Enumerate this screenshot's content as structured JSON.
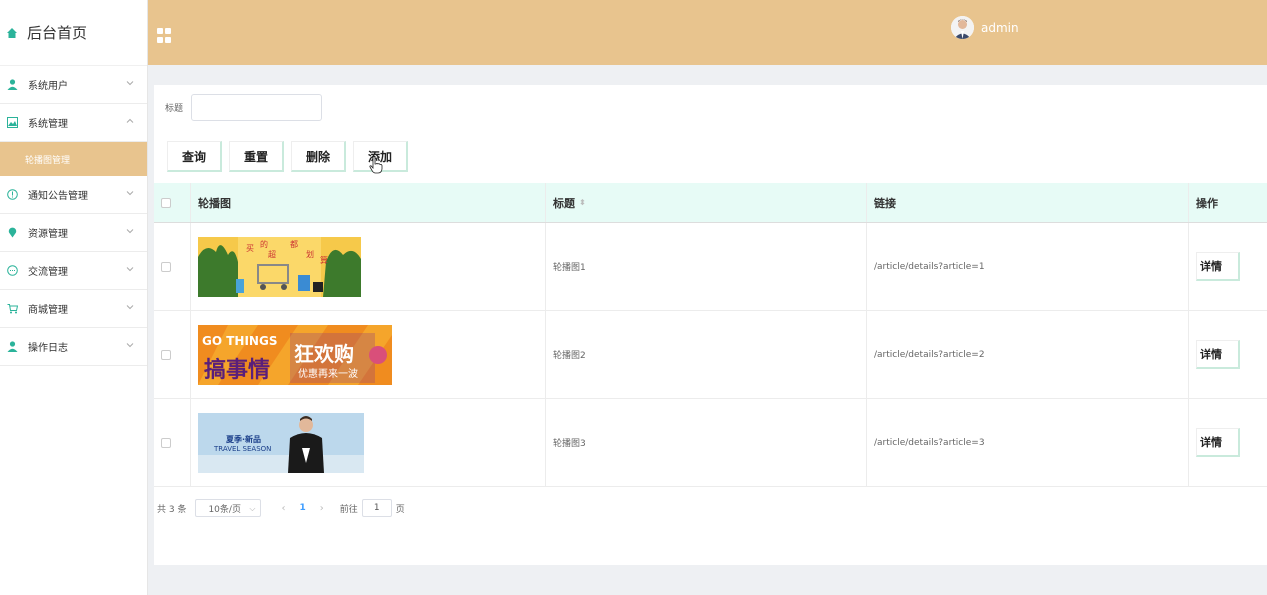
{
  "sidebar": {
    "brand": "后台首页",
    "items": [
      {
        "label": "系统用户",
        "icon": "user-icon",
        "expanded": false
      },
      {
        "label": "系统管理",
        "icon": "picture-icon",
        "expanded": true
      },
      {
        "label": "通知公告管理",
        "icon": "info-circle-icon",
        "expanded": false
      },
      {
        "label": "资源管理",
        "icon": "location-icon",
        "expanded": false
      },
      {
        "label": "交流管理",
        "icon": "chat-icon",
        "expanded": false
      },
      {
        "label": "商城管理",
        "icon": "cart-icon",
        "expanded": false
      },
      {
        "label": "操作日志",
        "icon": "user-icon",
        "expanded": false
      }
    ],
    "active_sub": "轮播图管理"
  },
  "header": {
    "username": "admin",
    "color": "#e8c48e"
  },
  "search": {
    "label": "标题",
    "value": "",
    "placeholder": ""
  },
  "toolbar": {
    "query": "查询",
    "reset": "重置",
    "delete": "删除",
    "add": "添加"
  },
  "table": {
    "columns": [
      "轮播图",
      "标题",
      "链接",
      "操作"
    ],
    "rows": [
      {
        "title": "轮播图1",
        "link": "/article/details?article=1",
        "action": "详情"
      },
      {
        "title": "轮播图2",
        "link": "/article/details?article=2",
        "action": "详情"
      },
      {
        "title": "轮播图3",
        "link": "/article/details?article=3",
        "action": "详情"
      }
    ]
  },
  "banners": [
    {
      "texts": [
        "买",
        "的",
        "超",
        "都",
        "划",
        "算"
      ]
    },
    {
      "texts": [
        "GO THINGS",
        "搞事情",
        "狂欢购",
        "优惠再来一波"
      ]
    },
    {
      "texts": [
        "夏季·新品",
        "TRAVEL SEASON"
      ]
    }
  ],
  "pagination": {
    "total": "共 3 条",
    "page_size": "10条/页",
    "current_page": "1",
    "goto_label": "前往",
    "goto_value": "1",
    "page_suffix": "页"
  }
}
